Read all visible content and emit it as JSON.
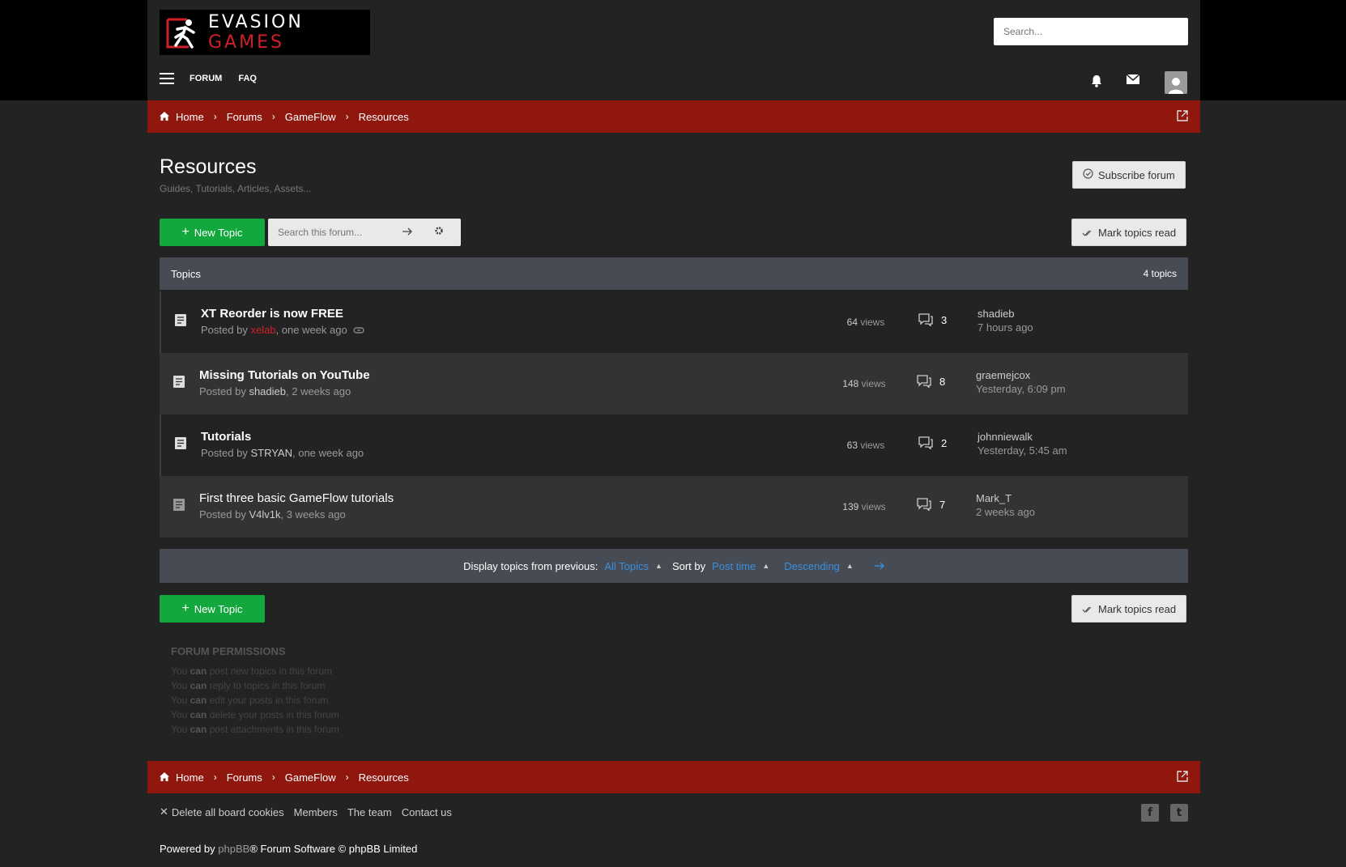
{
  "brand": {
    "part1": "EVASION",
    "part2": "GAMES"
  },
  "header": {
    "search_placeholder": "Search...",
    "nav": [
      "FORUM",
      "FAQ"
    ],
    "icons": [
      "menu-icon",
      "bell-icon",
      "envelope-icon",
      "user-icon"
    ]
  },
  "breadcrumb": {
    "items": [
      "Home",
      "Forums",
      "GameFlow",
      "Resources"
    ]
  },
  "page": {
    "title": "Resources",
    "subtitle": "Guides, Tutorials, Articles, Assets..."
  },
  "actions": {
    "subscribe": "Subscribe forum",
    "mark_read": "Mark topics read",
    "new_topic": "New Topic",
    "forum_search_placeholder": "Search this forum..."
  },
  "topics": {
    "header": "Topics",
    "count": "4 topics",
    "rows": [
      {
        "title": "XT Reorder is now FREE",
        "posted_prefix": "Posted by",
        "author": "xelab",
        "posted_when": ", one week ago",
        "views": "64",
        "views_label": "views",
        "replies": "3",
        "last_user": "shadieb",
        "last_when": "7 hours ago"
      },
      {
        "title": "Missing Tutorials on YouTube",
        "posted_prefix": "Posted by",
        "author": "shadieb",
        "posted_when": ", 2 weeks ago",
        "views": "148",
        "views_label": "views",
        "replies": "8",
        "last_user": "graemejcox",
        "last_when": "Yesterday, 6:09 pm"
      },
      {
        "title": "Tutorials",
        "posted_prefix": "Posted by",
        "author": "STRYAN",
        "posted_when": ", one week ago",
        "views": "63",
        "views_label": "views",
        "replies": "2",
        "last_user": "johnniewalk",
        "last_when": "Yesterday, 5:45 am"
      },
      {
        "title": "First three basic GameFlow tutorials",
        "posted_prefix": "Posted by",
        "author": "V4lv1k",
        "posted_when": ", 3 weeks ago",
        "views": "139",
        "views_label": "views",
        "replies": "7",
        "last_user": "Mark_T",
        "last_when": "2 weeks ago"
      }
    ]
  },
  "sort": {
    "display_label": "Display topics from previous:",
    "display_value": "All Topics",
    "sort_label": "Sort by",
    "sort_value": "Post time",
    "order_value": "Descending"
  },
  "permissions": {
    "title": "FORUM PERMISSIONS",
    "you": "You",
    "can": "can",
    "lines": [
      "post new topics in this forum",
      "reply to topics in this forum",
      "edit your posts in this forum",
      "delete your posts in this forum",
      "post attachments in this forum"
    ]
  },
  "footer": {
    "links": [
      "Delete all board cookies",
      "Members",
      "The team",
      "Contact us"
    ],
    "social": [
      "f",
      "t"
    ],
    "powered_prefix": "Powered by",
    "powered_phpbb": "phpBB",
    "powered_suffix": "® Forum Software © phpBB Limited"
  },
  "colors": {
    "accent_red": "#8f170d",
    "green": "#13a83d",
    "link_blue": "#3b8fe0"
  }
}
